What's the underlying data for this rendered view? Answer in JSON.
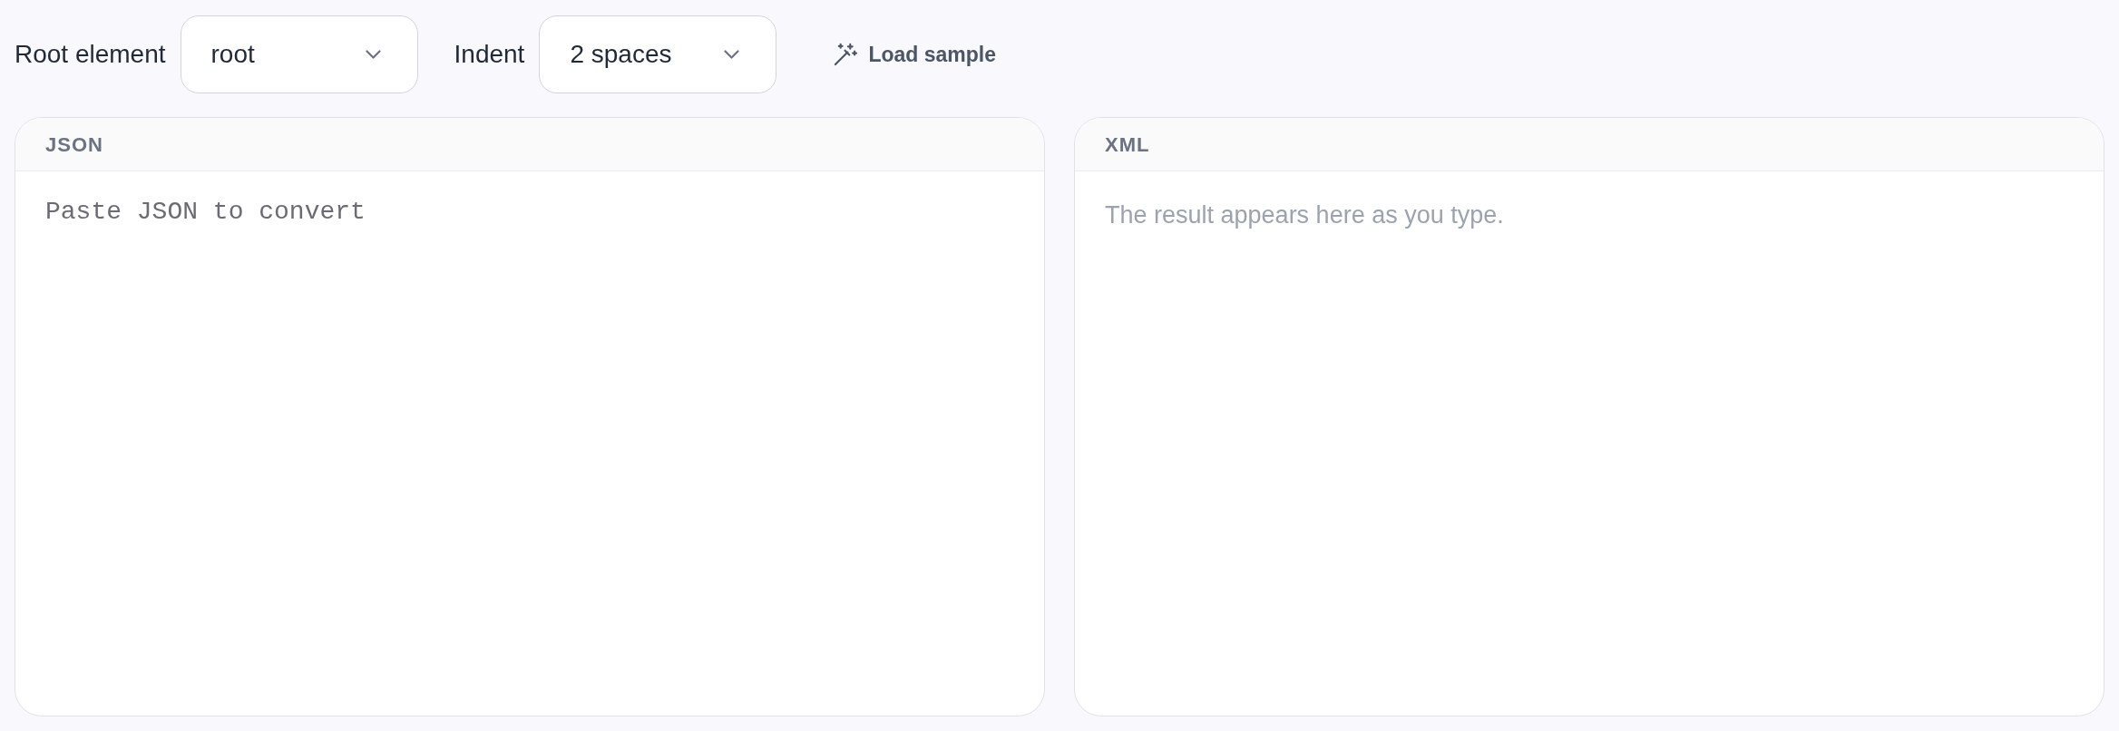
{
  "toolbar": {
    "fields": [
      {
        "label": "Root element",
        "value": "root"
      },
      {
        "label": "Indent",
        "value": "2 spaces"
      }
    ],
    "load_sample": "Load sample"
  },
  "panels": [
    {
      "kind": "input",
      "title": "JSON",
      "placeholder": "Paste JSON to convert"
    },
    {
      "kind": "output",
      "title": "XML",
      "placeholder": "The result appears here as you type."
    }
  ]
}
